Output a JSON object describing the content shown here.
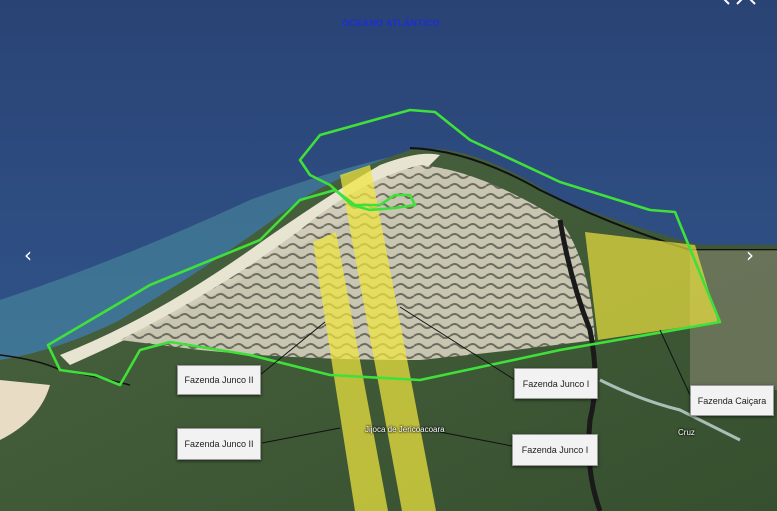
{
  "map": {
    "ocean_label": "OCEANO ATLÂNTICO",
    "places": {
      "jijoca": "Jijoca de Jericoacoara",
      "cruz": "Cruz"
    },
    "callouts": {
      "junco2_upper": "Fazenda Junco II",
      "junco2_lower": "Fazenda Junco II",
      "junco1_upper": "Fazenda Junco I",
      "junco1_lower": "Fazenda Junco I",
      "caicara": "Fazenda Caiçara"
    },
    "colors": {
      "boundary": "#3fe03a",
      "farm_fill": "#f0e640",
      "sea": "#2c4a78",
      "land": "#3f5a36",
      "dunes": "#d9d6c4"
    }
  },
  "nav": {
    "prev_icon": "‹",
    "next_icon": "›"
  }
}
